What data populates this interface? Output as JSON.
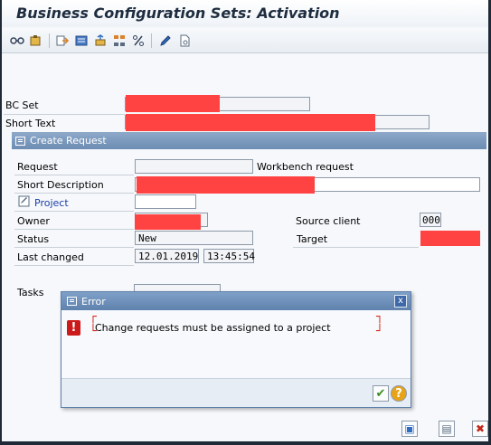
{
  "window": {
    "title": "Business Configuration Sets: Activation"
  },
  "toolbar": {
    "icons": [
      "glasses-icon",
      "tool-icon",
      "transfer-icon",
      "list-icon",
      "transport-icon",
      "hierarchy-icon",
      "percent-icon",
      "pen-icon",
      "document-icon"
    ]
  },
  "main": {
    "bc_set_label": "BC Set",
    "short_text_label": "Short Text"
  },
  "create_request": {
    "title": "Create Request",
    "request_label": "Request",
    "request_value": "",
    "request_type": "Workbench request",
    "short_description_label": "Short Description",
    "project_label": "Project",
    "owner_label": "Owner",
    "source_client_label": "Source client",
    "source_client_value": "000",
    "status_label": "Status",
    "status_value": "New",
    "target_label": "Target",
    "last_changed_label": "Last changed",
    "last_changed_date": "12.01.2019",
    "last_changed_time": "13:45:54",
    "tasks_label": "Tasks"
  },
  "error_dialog": {
    "title": "Error",
    "icon_symbol": "!",
    "message": "Change requests must be assigned to a project",
    "close_symbol": "x",
    "ok_symbol": "✔",
    "help_symbol": "?"
  },
  "footer": {
    "save_symbol": "▣",
    "other_symbol": "▤",
    "cancel_symbol": "✖"
  },
  "colors": {
    "redaction": "#ff4343",
    "header_blue": "#6c8cb3",
    "error_red": "#cc1a1a"
  }
}
